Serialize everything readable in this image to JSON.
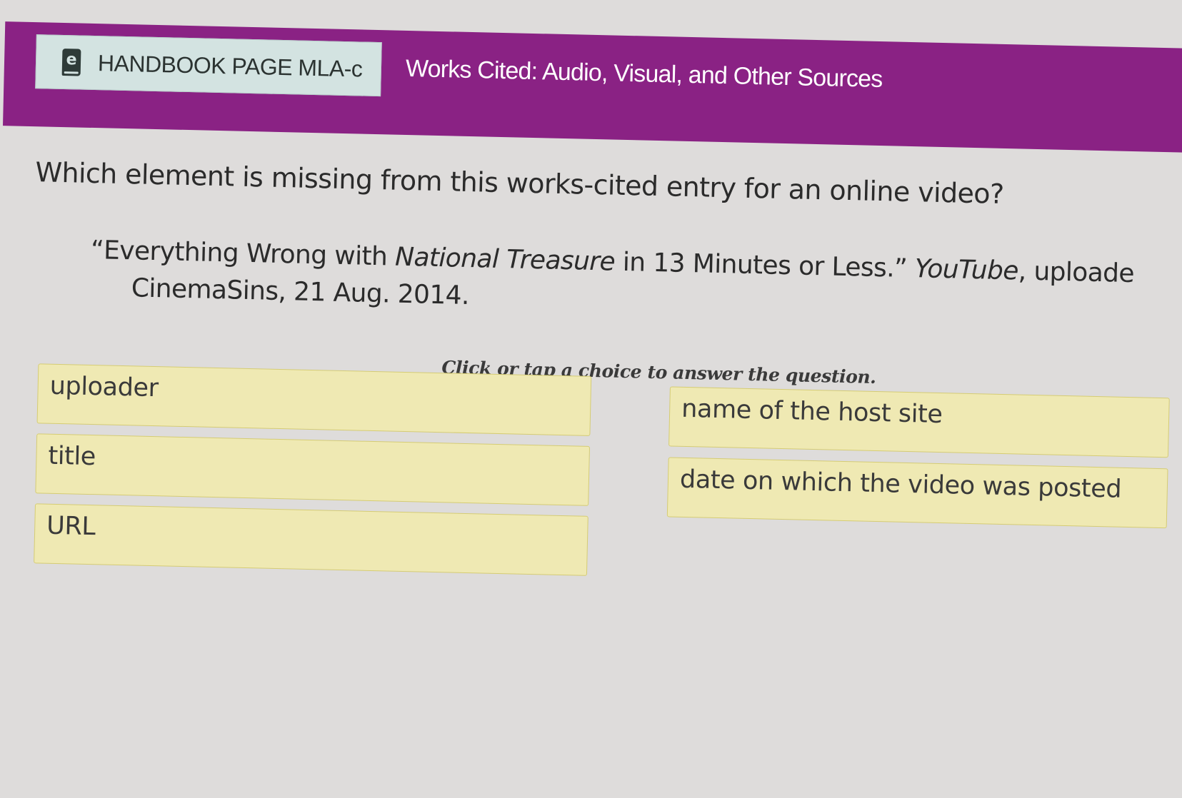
{
  "header": {
    "handbook_icon_glyph": "e",
    "handbook_icon": "ebook-icon",
    "handbook_label": "HANDBOOK PAGE MLA-c",
    "page_title": "Works Cited: Audio, Visual, and Other Sources",
    "bar_color": "#8a2284",
    "button_color": "#d3e3e1"
  },
  "question": {
    "prompt": "Which element is missing from this works-cited entry for an online video?",
    "citation": {
      "open_quote": "“Everything Wrong with ",
      "italic_title": "National Treasure",
      "title_rest": " in 13 Minutes or Less.” ",
      "italic_site": "YouTube",
      "after_site": ", uploade",
      "line2": "CinemaSins, 21 Aug. 2014."
    },
    "instruction": "Click or tap a choice to answer the question."
  },
  "choices": {
    "left": [
      "uploader",
      "title",
      "URL"
    ],
    "right": [
      "name of the host site",
      "date on which the video was posted"
    ],
    "fill_color": "#efe9b3",
    "border_color": "#d5cc74"
  }
}
